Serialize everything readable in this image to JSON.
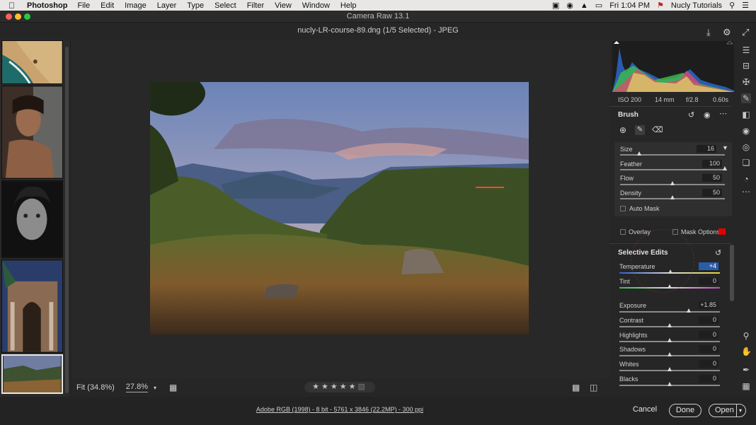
{
  "menubar": {
    "app": "Photoshop",
    "items": [
      "File",
      "Edit",
      "Image",
      "Layer",
      "Type",
      "Select",
      "Filter",
      "View",
      "Window",
      "Help"
    ],
    "time": "Fri 1:04 PM",
    "user": "Nucly Tutorials"
  },
  "window": {
    "title": "Camera Raw 13.1"
  },
  "document": {
    "title": "nucly-LR-course-89.dng (1/5 Selected)  -  JPEG"
  },
  "metadata": {
    "iso": "ISO 200",
    "focal": "14 mm",
    "aperture": "f/2.8",
    "shutter": "0.60s"
  },
  "brush": {
    "title": "Brush",
    "size_label": "Size",
    "size_value": "16",
    "size_level": 0.18,
    "feather_label": "Feather",
    "feather_value": "100",
    "feather_level": 1.0,
    "flow_label": "Flow",
    "flow_value": "50",
    "flow_level": 0.5,
    "density_label": "Density",
    "density_value": "50",
    "density_level": 0.5,
    "automask_label": "Auto Mask"
  },
  "overlay": {
    "overlay_label": "Overlay",
    "maskoptions_label": "Mask Options",
    "mask_color": "#e00000"
  },
  "selective": {
    "title": "Selective Edits",
    "sliders": [
      {
        "label": "Temperature",
        "value": "+4",
        "level": 0.51,
        "kind": "temp"
      },
      {
        "label": "Tint",
        "value": "0",
        "level": 0.5,
        "kind": "tint"
      },
      {
        "label": "Exposure",
        "value": "+1.85",
        "level": 0.69,
        "kind": "plain"
      },
      {
        "label": "Contrast",
        "value": "0",
        "level": 0.5,
        "kind": "plain"
      },
      {
        "label": "Highlights",
        "value": "0",
        "level": 0.5,
        "kind": "plain"
      },
      {
        "label": "Shadows",
        "value": "0",
        "level": 0.5,
        "kind": "plain"
      },
      {
        "label": "Whites",
        "value": "0",
        "level": 0.5,
        "kind": "plain"
      },
      {
        "label": "Blacks",
        "value": "0",
        "level": 0.5,
        "kind": "plain"
      }
    ]
  },
  "canvasbar": {
    "fit": "Fit (34.8%)",
    "zoom": "27.8%",
    "rating": 0
  },
  "status": {
    "info": "Adobe RGB (1998) - 8 bit - 5761 x 3846 (22.2MP) - 300 ppi",
    "cancel": "Cancel",
    "done": "Done",
    "open": "Open"
  },
  "colors": {
    "accent": "#1473e6",
    "mask": "#e00000"
  }
}
